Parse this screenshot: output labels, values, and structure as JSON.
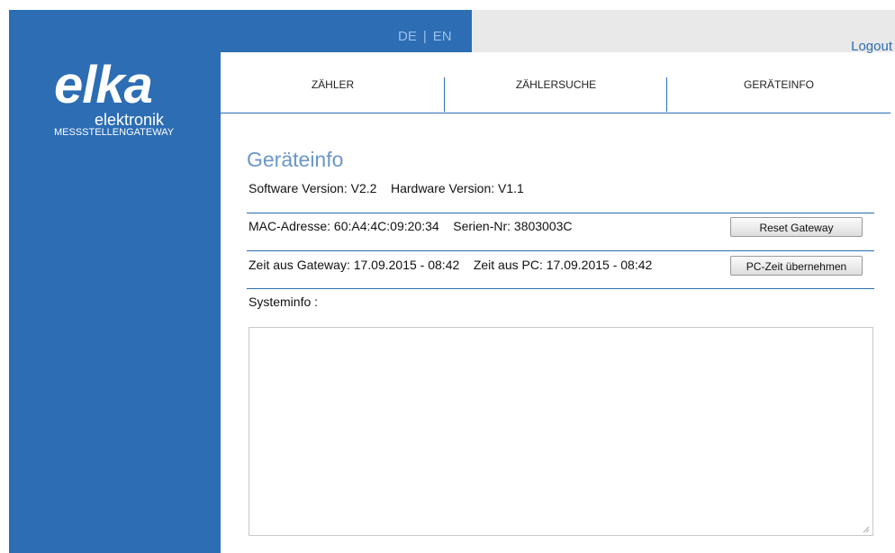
{
  "header": {
    "lang_de": "DE",
    "lang_sep": "|",
    "lang_en": "EN",
    "logout": "Logout"
  },
  "brand": {
    "logo_text": "elka",
    "logo_subtext": "elektronik",
    "tagline": "MESSSTELLENGATEWAY",
    "color_primary": "#2c6db4"
  },
  "nav": {
    "items": [
      "ZÄHLER",
      "ZÄHLERSUCHE",
      "GERÄTEINFO"
    ]
  },
  "main": {
    "title": "Geräteinfo",
    "version_line": "Software Version: V2.2    Hardware Version: V1.1",
    "mac_line": "MAC-Adresse: 60:A4:4C:09:20:34    Serien-Nr: 3803003C",
    "reset_button": "Reset Gateway",
    "time_line": "Zeit aus Gateway: 17.09.2015 - 08:42    Zeit aus PC: 17.09.2015 - 08:42",
    "pc_time_button": "PC-Zeit übernehmen",
    "systeminfo_label": "Systeminfo :",
    "systeminfo_value": ""
  }
}
